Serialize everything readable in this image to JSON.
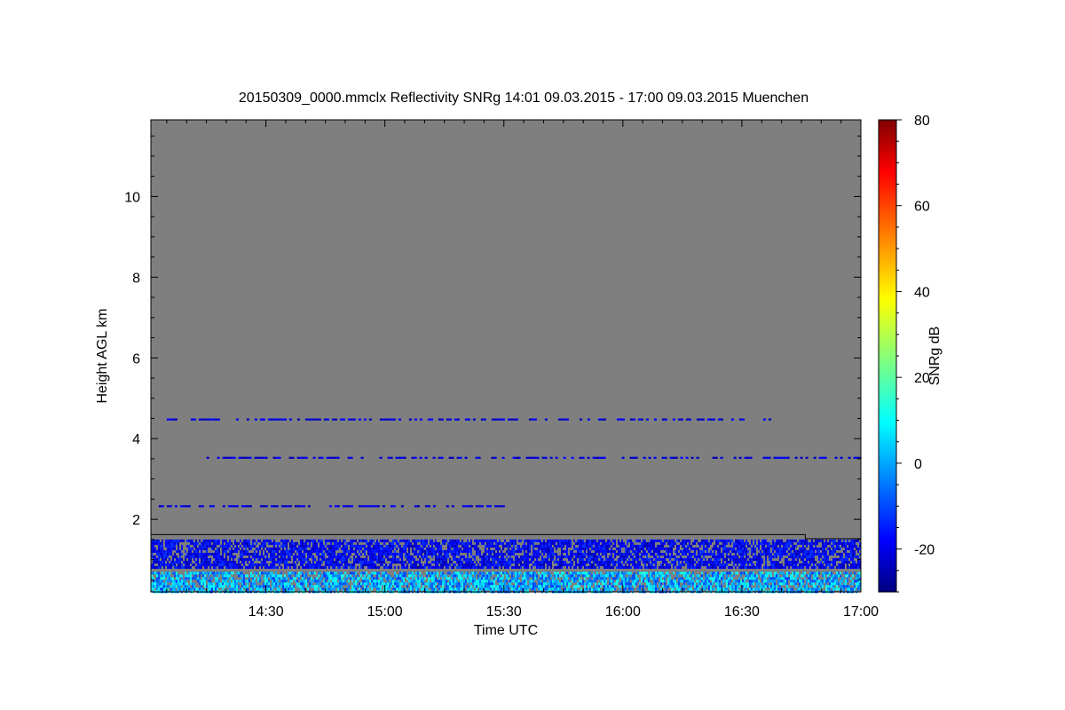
{
  "chart_data": {
    "type": "heatmap",
    "title": "20150309_0000.mmclx Reflectivity SNRg   14:01 09.03.2015 - 17:00 09.03.2015 Muenchen",
    "xlabel": "Time UTC",
    "ylabel": "Height AGL km",
    "colorbar_label": "SNRg dB",
    "x_range": [
      "14:01",
      "17:00"
    ],
    "y_range_km": [
      0.2,
      11.9
    ],
    "x_ticks": [
      {
        "label": "14:30",
        "minutes": 870
      },
      {
        "label": "15:00",
        "minutes": 900
      },
      {
        "label": "15:30",
        "minutes": 930
      },
      {
        "label": "16:00",
        "minutes": 960
      },
      {
        "label": "16:30",
        "minutes": 990
      },
      {
        "label": "17:00",
        "minutes": 1020
      }
    ],
    "y_ticks": [
      2,
      4,
      6,
      8,
      10
    ],
    "colorbar_range": [
      -30,
      80
    ],
    "colorbar_ticks": [
      -20,
      0,
      20,
      40,
      60,
      80
    ],
    "colormap": "jet",
    "no_signal_color": "#7f7f7f",
    "boundary_line": {
      "description": "black line",
      "segments": [
        {
          "from": "14:01",
          "to": "16:46",
          "height_km": 1.62
        },
        {
          "from": "16:46",
          "to": "17:00",
          "height_km": 1.52
        }
      ]
    },
    "echo_bands": [
      {
        "from": "14:01",
        "to": "17:00",
        "height_km": [
          0.2,
          0.7
        ],
        "snr_db": [
          -10,
          15
        ],
        "note": "surface clutter / boundary layer"
      },
      {
        "from": "14:01",
        "to": "17:00",
        "height_km": [
          0.8,
          1.5
        ],
        "snr_db": [
          -25,
          -10
        ]
      },
      {
        "from": "14:03",
        "to": "15:30",
        "height_km": [
          2.3,
          2.35
        ],
        "snr_db": [
          -25,
          -15
        ]
      },
      {
        "from": "14:15",
        "to": "17:00",
        "height_km": [
          3.5,
          3.55
        ],
        "snr_db": [
          -25,
          -15
        ]
      },
      {
        "from": "14:03",
        "to": "16:40",
        "height_km": [
          4.45,
          4.5
        ],
        "snr_db": [
          -25,
          -15
        ]
      }
    ]
  }
}
